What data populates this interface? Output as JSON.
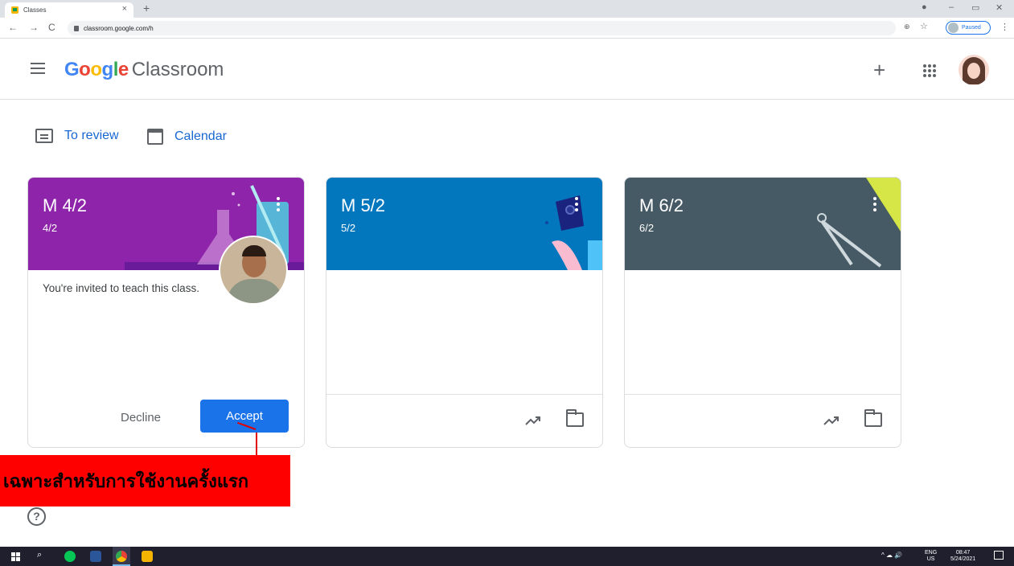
{
  "browser": {
    "tab_title": "Classes",
    "tab_close": "×",
    "new_tab": "+",
    "url": "classroom.google.com/h",
    "profile_status": "Paused",
    "back": "←",
    "forward": "→",
    "reload": "C",
    "zoom_icon": "⊕",
    "star_icon": "☆",
    "menu_dots": "⋮",
    "record_icon": "●",
    "minimize": "–",
    "restore": "▭",
    "close": "✕"
  },
  "header": {
    "logo_google": [
      "G",
      "o",
      "o",
      "g",
      "l",
      "e"
    ],
    "logo_colors": [
      "#4285f4",
      "#ea4335",
      "#fbbc04",
      "#4285f4",
      "#34a853",
      "#ea4335"
    ],
    "logo_product": "Classroom",
    "plus": "+"
  },
  "nav": {
    "to_review": "To review",
    "calendar": "Calendar"
  },
  "cards": [
    {
      "title": "M 4/2",
      "section": "4/2",
      "color": "#8e24aa",
      "invite_text": "You're invited to teach this class.",
      "decline": "Decline",
      "accept": "Accept"
    },
    {
      "title": "M 5/2",
      "section": "5/2",
      "color": "#0277bd"
    },
    {
      "title": "M 6/2",
      "section": "6/2",
      "color": "#455a64"
    }
  ],
  "annotation": {
    "text": "เฉพาะสำหรับการใช้งานครั้งแรก",
    "color": "#ff0000"
  },
  "help": "?",
  "taskbar": {
    "search_icon": "⌕",
    "tray_lang_1": "ENG",
    "tray_lang_2": "US",
    "time": "08:47",
    "date": "5/24/2021",
    "tray_icons": "^ ☁ 🔊"
  }
}
